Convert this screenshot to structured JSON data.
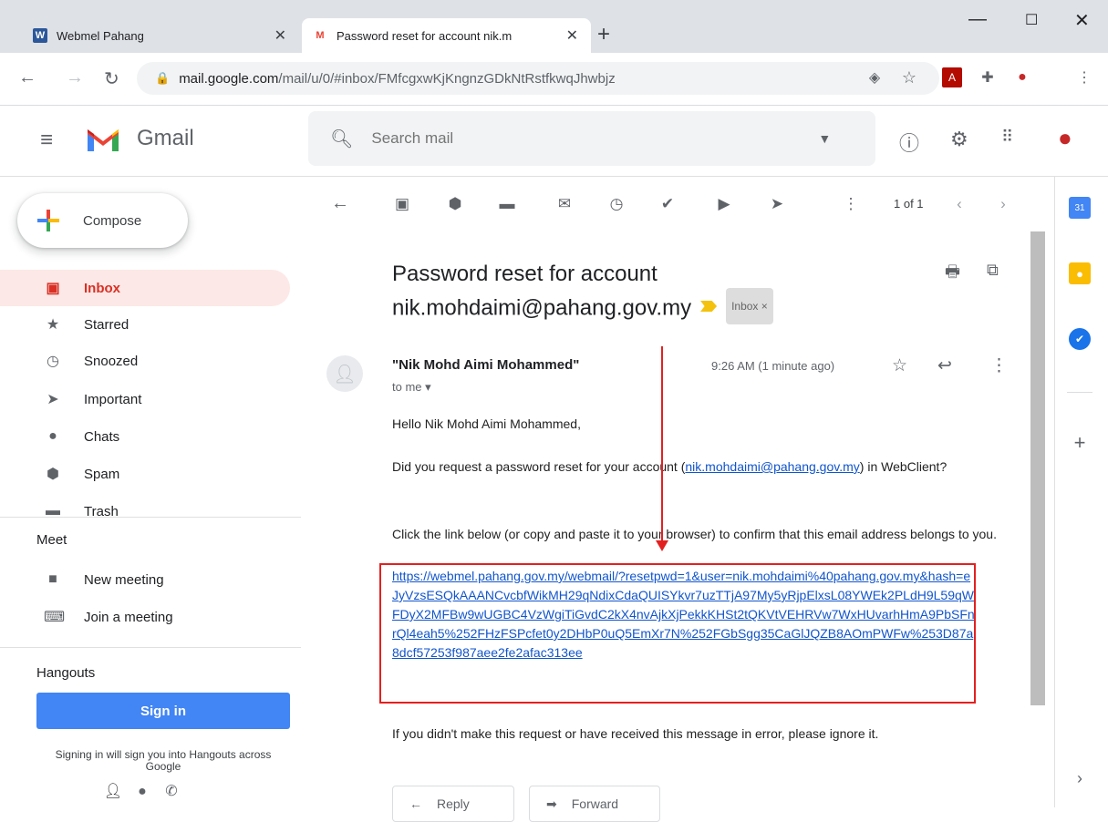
{
  "browser": {
    "tabs": [
      {
        "label": "Webmel Pahang",
        "favicon": "W",
        "active": false
      },
      {
        "label": "Password reset for account nik.m",
        "favicon": "M",
        "active": true
      }
    ],
    "new_tab": "+",
    "url_host": "mail.google.com",
    "url_path": "/mail/u/0/#inbox/FMfcgxwKjKngnzGDkNtRstfkwqJhwbjz"
  },
  "header": {
    "app_name": "Gmail",
    "search_placeholder": "Search mail"
  },
  "sidebar": {
    "compose_label": "Compose",
    "items": [
      {
        "label": "Inbox",
        "icon": "inbox-icon",
        "selected": true
      },
      {
        "label": "Starred",
        "icon": "star-icon"
      },
      {
        "label": "Snoozed",
        "icon": "clock-icon"
      },
      {
        "label": "Important",
        "icon": "important-icon"
      },
      {
        "label": "Chats",
        "icon": "chat-icon"
      },
      {
        "label": "Spam",
        "icon": "spam-icon"
      },
      {
        "label": "Trash",
        "icon": "trash-icon"
      }
    ],
    "meet": {
      "title": "Meet",
      "items": [
        {
          "label": "New meeting",
          "icon": "video-icon"
        },
        {
          "label": "Join a meeting",
          "icon": "keyboard-icon"
        }
      ]
    },
    "hangouts": {
      "title": "Hangouts",
      "signin_label": "Sign in",
      "note": "Signing in will sign you into Hangouts across Google"
    }
  },
  "toolbar": {
    "count": "1 of 1"
  },
  "email": {
    "subject": "Password reset for account nik.mohdaimi@pahang.gov.my",
    "label_chip": "Inbox ×",
    "sender": "\"Nik Mohd Aimi Mohammed\"",
    "to": "to me ▾",
    "time": "9:26 AM (1 minute ago)",
    "greeting": "Hello Nik Mohd Aimi Mohammed,",
    "para1_before": "Did you request a password reset for your account (",
    "para1_link": "nik.mohdaimi@pahang.gov.my",
    "para1_after": ") in WebClient?",
    "para2": "Click the link below (or copy and paste it to your browser) to confirm that this email address belongs to you.",
    "reset_link": "https://webmel.pahang.gov.my/webmail/?resetpwd=1&user=nik.mohdaimi%40pahang.gov.my&hash=eJyVzsESQkAAANCvcbfWikMH29qNdixCdaQUISYkvr7uzTTjA97My5yRjpElxsL08YWEk2PLdH9L59qWFDyX2MFBw9wUGBC4VzWgiTiGvdC2kX4nvAjkXjPekkKHSt2tQKVtVEHRVw7WxHUvarhHmA9PbSFnrQl4eah5%252FHzFSPcfet0y2DHbP0uQ5EmXr7N%252FGbSgg35CaGlJQZB8AOmPWFw%253D87a8dcf57253f987aee2fe2afac313ee",
    "para3": "If you didn't make this request or have received this message in error, please ignore it.",
    "reply_label": "Reply",
    "forward_label": "Forward"
  },
  "colors": {
    "accent_red": "#e32020",
    "link": "#1155cc",
    "inbox_selected_bg": "#fce8e6",
    "signin_blue": "#4285f4"
  }
}
